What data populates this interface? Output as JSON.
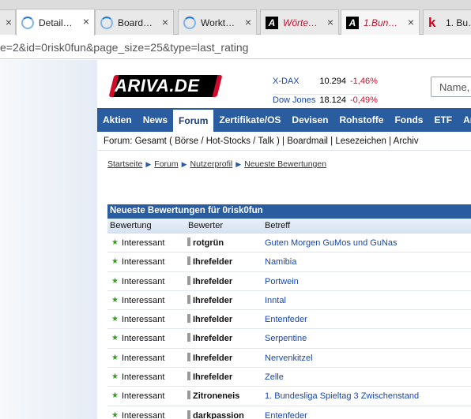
{
  "browser": {
    "tabs": [
      {
        "title": "",
        "icon": "close-icon",
        "kind": "partial"
      },
      {
        "title": "Detail…",
        "icon": "loading-spinner-icon",
        "kind": "active"
      },
      {
        "title": "Board…",
        "icon": "loading-spinner-icon",
        "kind": "normal"
      },
      {
        "title": "Workt…",
        "icon": "loading-spinner-icon",
        "kind": "normal"
      },
      {
        "title": "Wörte…",
        "icon": "ariva-icon",
        "kind": "red"
      },
      {
        "title": "1.Bun…",
        "icon": "ariva-icon",
        "kind": "red"
      },
      {
        "title": "1. Bu…",
        "icon": "k-logo-icon",
        "kind": "normal"
      }
    ],
    "close_glyph": "×",
    "url": "e=2&id=0risk0fun&page_size=25&type=last_rating"
  },
  "site": {
    "logo_text": "ARIVA.DE",
    "ticker": [
      {
        "name": "X-DAX",
        "value": "10.294",
        "change": "-1,46%"
      },
      {
        "name": "Dow Jones",
        "value": "18.124",
        "change": "-0,49%"
      }
    ],
    "search_placeholder": "Name,",
    "nav": [
      "Aktien",
      "News",
      "Forum",
      "Zertifikate/OS",
      "Devisen",
      "Rohstoffe",
      "Fonds",
      "ETF",
      "Anle"
    ],
    "nav_active": "Forum",
    "subnav": "Forum: Gesamt ( Börse / Hot-Stocks / Talk ) | Boardmail | Lesezeichen | Archiv",
    "breadcrumb": [
      "Startseite",
      "Forum",
      "Nutzerprofil",
      "Neueste Bewertungen"
    ],
    "breadcrumb_arrow": "▶",
    "box_title": "Neueste Bewertungen für 0risk0fun",
    "columns": [
      "Bewertung",
      "Bewerter",
      "Betreff"
    ],
    "star_glyph": "★",
    "rows": [
      {
        "rating": "Interessant",
        "user": "rotgrün",
        "subject": "Guten Morgen GuMos und GuNas"
      },
      {
        "rating": "Interessant",
        "user": "Ihrefelder",
        "subject": "Namibia"
      },
      {
        "rating": "Interessant",
        "user": "Ihrefelder",
        "subject": "Portwein"
      },
      {
        "rating": "Interessant",
        "user": "Ihrefelder",
        "subject": "Inntal"
      },
      {
        "rating": "Interessant",
        "user": "Ihrefelder",
        "subject": "Entenfeder"
      },
      {
        "rating": "Interessant",
        "user": "Ihrefelder",
        "subject": "Serpentine"
      },
      {
        "rating": "Interessant",
        "user": "Ihrefelder",
        "subject": "Nervenkitzel"
      },
      {
        "rating": "Interessant",
        "user": "Ihrefelder",
        "subject": "Zelle"
      },
      {
        "rating": "Interessant",
        "user": "Zitroneneis",
        "subject": "1. Bundesliga Spieltag 3 Zwischenstand"
      },
      {
        "rating": "Interessant",
        "user": "darkpassion",
        "subject": "Entenfeder"
      }
    ]
  },
  "colors": {
    "nav_bg": "#2a5d9f",
    "link": "#1a46a8",
    "negative": "#d10a2a",
    "star": "#3a9a24"
  }
}
